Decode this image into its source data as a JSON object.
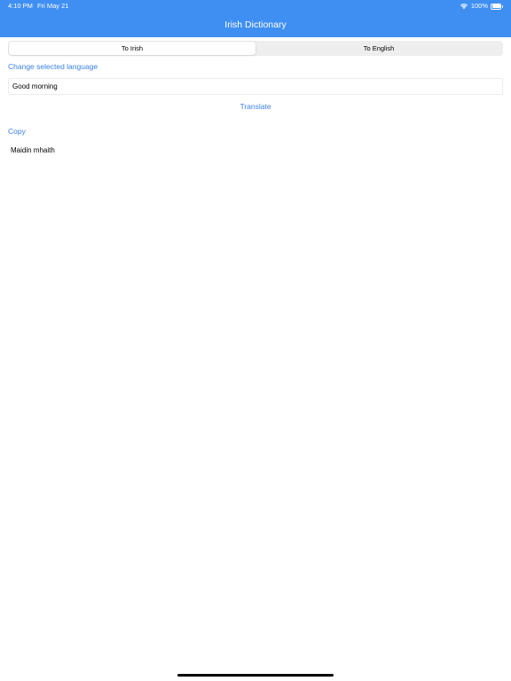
{
  "status_bar": {
    "time": "4:10 PM",
    "date": "Fri May 21",
    "battery": "100%",
    "icons": [
      "wifi-icon",
      "battery-icon"
    ]
  },
  "nav": {
    "title": "Irish Dictionary"
  },
  "segmented": {
    "options": [
      "To Irish",
      "To English"
    ],
    "selected": "To Irish"
  },
  "change_language_label": "Change selected language",
  "input": {
    "value": "Good morning"
  },
  "translate_label": "Translate",
  "copy_label": "Copy",
  "result": "Maidin mhaith",
  "colors": {
    "accent": "#3f8ff3",
    "link": "#3b82e6"
  }
}
